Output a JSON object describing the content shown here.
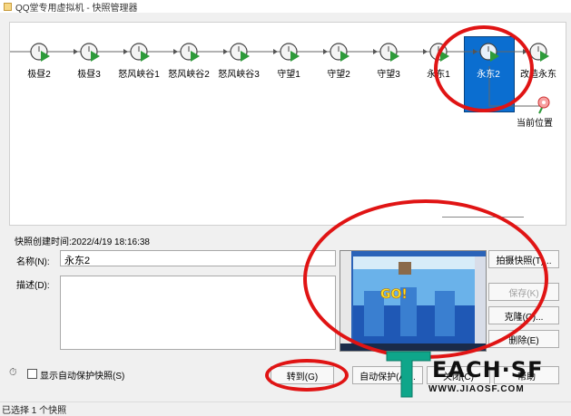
{
  "window": {
    "title": "QQ堂专用虚拟机 - 快照管理器"
  },
  "timeline": {
    "nodes": [
      {
        "label": "极昼2"
      },
      {
        "label": "极昼3"
      },
      {
        "label": "怒风峡谷1"
      },
      {
        "label": "怒风峡谷2"
      },
      {
        "label": "怒风峡谷3"
      },
      {
        "label": "守望1"
      },
      {
        "label": "守望2"
      },
      {
        "label": "守望3"
      },
      {
        "label": "永东1"
      },
      {
        "label": "永东2"
      },
      {
        "label": "改造永东"
      }
    ],
    "current_position": "当前位置",
    "selected": "永东2"
  },
  "details": {
    "created": "快照创建时间:2022/4/19 18:16:38",
    "name_label": "名称(N):",
    "name_value": "永东2",
    "desc_label": "描述(D):",
    "desc_value": ""
  },
  "buttons": {
    "take_snapshot": "拍摄快照(T)...",
    "save": "保存(K)",
    "clone": "克隆(O)...",
    "delete": "删除(E)",
    "goto": "转到(G)",
    "autoprotect": "自动保护(A)...",
    "close": "关闭(C)",
    "help": "帮助"
  },
  "options": {
    "show_autoprotect": "显示自动保护快照(S)"
  },
  "status": {
    "text": "已选择 1 个快照"
  },
  "thumbnail": {
    "text": "GO!"
  },
  "watermark": {
    "brand": "EACH·SF",
    "url": "WWW.JIAOSF.COM"
  },
  "colors": {
    "selected": "#0b6ed0",
    "node_green": "#2e9b3a",
    "highlight": "#e01414"
  }
}
